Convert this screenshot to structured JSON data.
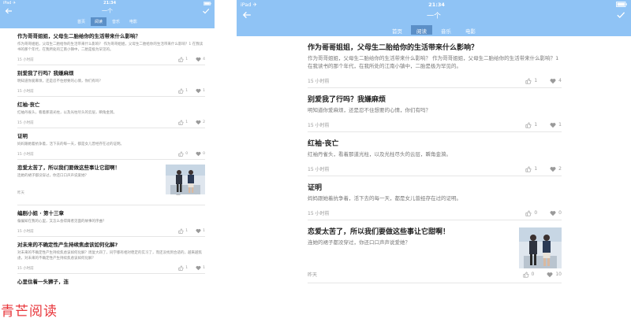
{
  "phone": {
    "status": {
      "left": "iPad ✈",
      "time": "21:34",
      "right": ""
    },
    "title": "一个",
    "tabs": [
      {
        "label": "首页",
        "active": false
      },
      {
        "label": "阅读",
        "active": true
      },
      {
        "label": "音乐",
        "active": false
      },
      {
        "label": "电影",
        "active": false
      }
    ],
    "items": [
      {
        "title": "作为哥哥姐姐，父母生二胎给你的生活带来什么影响？",
        "desc": "作为哥哥姐姐，父母生二胎给你的生活带来什么影响？ 作为哥哥姐姐，父母生二胎给你的生活带来什么影响？1 在我读书的那个年代，在我所处的江南小镇中，二胎是极为罕见的。",
        "time": "15 小时前",
        "likes": "1",
        "hearts": "4"
      },
      {
        "title": "别爱我了行吗？我嫌麻烦",
        "desc": "明知道你爱麻烦，还是忍不住想要的心情，你们有吗？",
        "time": "15 小时前",
        "likes": "1",
        "hearts": "1"
      },
      {
        "title": "红袖·丧亡",
        "desc": "红袖丹雀头，看着那道光柱，以及光柱尽头的云层，瞬角金漪。",
        "time": "15 小时前",
        "likes": "1",
        "hearts": "2"
      },
      {
        "title": "证明",
        "desc": "妈妈跟她着抗争着，活下去的每一天，都是女儿曾经存在过的证明。",
        "time": "15 小时前",
        "likes": "0",
        "hearts": "0"
      },
      {
        "title": "恋爱太苦了，所以我们要做这些事让它甜啊！",
        "desc": "连她的裙子都没穿过，你还口口声声说爱她？",
        "time": "昨天",
        "likes": "0",
        "hearts": "10",
        "has_image": true
      },
      {
        "title": "编剧小姐 · 第十三章",
        "desc": "偏偏知在我的心里，又怎么会得兩者见面的故事的序曲？",
        "time": "15 小时前",
        "likes": "1",
        "hearts": "1"
      },
      {
        "title": "对未来的不确定性产生持续焦虑该如何化解?",
        "desc": "对未来的不确定性产生持续焦虑该如何化解？周复大四了，同学都有相对稳定的实习了，而还没找到合适的，越来越焦虑，对未来的不确定性产生持续焦虑该如何化解？",
        "time": "15 小时前",
        "likes": "1",
        "hearts": "1"
      },
      {
        "title": "心里住着一头狮子，连",
        "desc": "",
        "time": "",
        "likes": "",
        "hearts": ""
      }
    ]
  },
  "tablet": {
    "status": {
      "left": "iPad ✈",
      "time": "21:34",
      "right": ""
    },
    "title": "一个",
    "tabs": [
      {
        "label": "首页",
        "active": false
      },
      {
        "label": "阅读",
        "active": true
      },
      {
        "label": "音乐",
        "active": false
      },
      {
        "label": "电影",
        "active": false
      }
    ],
    "items": [
      {
        "title": "作为哥哥姐姐，父母生二胎给你的生活带来什么影响？",
        "desc": "作为哥哥姐姐，父母生二胎给你的生活带来什么影响？ 作为哥哥姐姐，父母生二胎给你的生活带来什么影响？1 在我读书的那个年代，在我所处的江南小镇中，二胎是极为罕见的。",
        "time": "15 小时前",
        "likes": "1",
        "hearts": "4"
      },
      {
        "title": "别爱我了行吗？我嫌麻烦",
        "desc": "明知道你爱麻烦，还是忍不住想要的心情，你们有吗？",
        "time": "15 小时前",
        "likes": "1",
        "hearts": "1"
      },
      {
        "title": "红袖·丧亡",
        "desc": "红袖丹雀头，看着那道光柱，以及光柱尽头的云层，瞬角金漪。",
        "time": "15 小时前",
        "likes": "1",
        "hearts": "2"
      },
      {
        "title": "证明",
        "desc": "妈妈跟她着抗争着，活下去的每一天，都是女儿曾经存在过的证明。",
        "time": "15 小时前",
        "likes": "0",
        "hearts": "0"
      },
      {
        "title": "恋爱太苦了，所以我们要做这些事让它甜啊！",
        "desc": "连她的裙子都没穿过，你还口口声声说爱她？",
        "time": "昨天",
        "likes": "0",
        "hearts": "10",
        "has_image": true
      }
    ]
  },
  "watermark": "青芒阅读",
  "colors": {
    "nav_bg": "#8fc3f5",
    "tab_active": "#5b8fc7",
    "watermark": "#e8363b"
  }
}
